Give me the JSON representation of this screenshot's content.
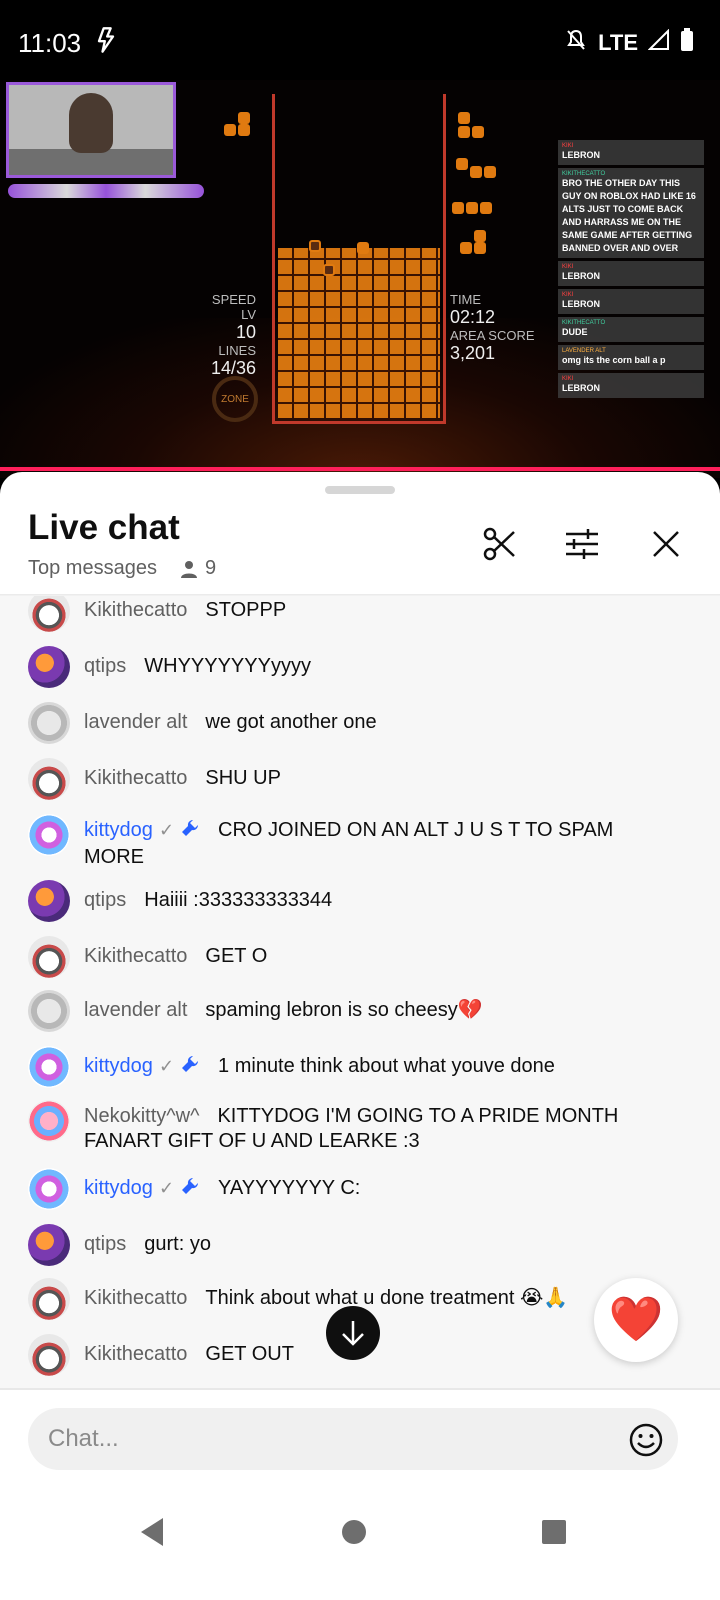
{
  "status_bar": {
    "time": "11:03",
    "network": "LTE"
  },
  "video": {
    "hud": {
      "speed_label": "SPEED LV",
      "speed_value": "10",
      "lines_label": "LINES",
      "lines_value": "14/36",
      "time_label": "TIME",
      "time_value": "02:12",
      "area_label": "AREA SCORE",
      "area_value": "3,201",
      "zone_label": "ZONE"
    },
    "overlay_chat": [
      {
        "name": "KIKI",
        "text": "LEBRON"
      },
      {
        "name": "KIKITHECATTO",
        "text": "BRO THE OTHER DAY THIS GUY ON ROBLOX HAD LIKE 16 ALTS JUST TO COME BACK AND HARRASS ME ON THE SAME GAME AFTER GETTING BANNED OVER AND OVER"
      },
      {
        "name": "KIKI",
        "text": "LEBRON"
      },
      {
        "name": "KIKI",
        "text": "LEBRON"
      },
      {
        "name": "KIKITHECATTO",
        "text": "DUDE"
      },
      {
        "name": "LAVENDER ALT",
        "text": "omg its the corn ball a p"
      },
      {
        "name": "KIKI",
        "text": "LEBRON"
      }
    ]
  },
  "chat_panel": {
    "title": "Live chat",
    "mode_label": "Top messages",
    "viewer_count": "9",
    "icons": {
      "clip": "scissors-icon",
      "filter": "tune-icon",
      "close": "close-icon"
    }
  },
  "messages": [
    {
      "author": "Kikithecatto",
      "text": "STOPPP",
      "avatar": "kiki",
      "mod": false
    },
    {
      "author": "qtips",
      "text": "WHYYYYYYYyyyy",
      "avatar": "qtips",
      "mod": false
    },
    {
      "author": "lavender alt",
      "text": "we got another one",
      "avatar": "lav",
      "mod": false
    },
    {
      "author": "Kikithecatto",
      "text": "SHU UP",
      "avatar": "kiki",
      "mod": false
    },
    {
      "author": "kittydog",
      "text": "CRO JOINED ON AN ALT J U S T TO SPAM MORE",
      "avatar": "kitty",
      "mod": true
    },
    {
      "author": "qtips",
      "text": "Haiiii :333333333344",
      "avatar": "qtips",
      "mod": false
    },
    {
      "author": "Kikithecatto",
      "text": "GET O",
      "avatar": "kiki",
      "mod": false
    },
    {
      "author": "lavender alt",
      "text": "spaming lebron is so cheesy💔",
      "avatar": "lav",
      "mod": false
    },
    {
      "author": "kittydog",
      "text": "1 minute think about what youve done",
      "avatar": "kitty",
      "mod": true
    },
    {
      "author": "Nekokitty^w^",
      "text": "KITTYDOG I'M GOING TO A PRIDE MONTH FANART GIFT OF U AND LEARKE :3",
      "avatar": "neko",
      "mod": false
    },
    {
      "author": "kittydog",
      "text": "YAYYYYYYY C:",
      "avatar": "kitty",
      "mod": true
    },
    {
      "author": "qtips",
      "text": "gurt: yo",
      "avatar": "qtips",
      "mod": false
    },
    {
      "author": "Kikithecatto",
      "text": "Think about what u done treatment 😭🙏",
      "avatar": "kiki",
      "mod": false
    },
    {
      "author": "Kikithecatto",
      "text": "GET OUT",
      "avatar": "kiki",
      "mod": false
    }
  ],
  "badges": {
    "verified": "✓"
  },
  "input": {
    "placeholder": "Chat..."
  },
  "reaction": {
    "emoji": "❤️"
  },
  "colors": {
    "accent": "#ff1f5a",
    "mod_name": "#2962ff",
    "author_name": "#606060"
  }
}
